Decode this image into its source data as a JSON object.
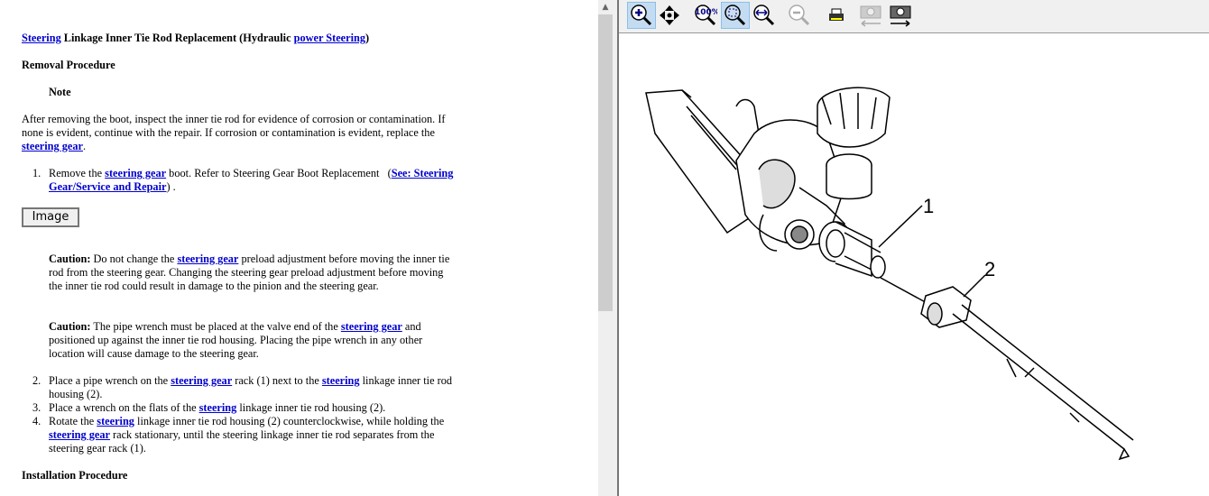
{
  "document": {
    "title": {
      "link1": "Steering",
      "text": " Linkage Inner Tie Rod Replacement (Hydraulic ",
      "link2": "power Steering",
      "end": ")"
    },
    "removal_heading": "Removal Procedure",
    "note_label": "Note",
    "note_text": {
      "a": "After removing the boot, inspect the inner tie rod for evidence of corrosion or contamination. If none is evident, continue with the repair. If corrosion or contamination is evident, replace the ",
      "link": "steering gear",
      "b": "."
    },
    "step1": {
      "num": "1.",
      "a": "Remove the ",
      "link": "steering gear",
      "b": " boot. Refer to Steering Gear Boot Replacement   (",
      "link2": "See: Steering Gear/Service and Repair",
      "c": ") ."
    },
    "image_button": "Image",
    "caution1": {
      "label": "Caution:",
      "a": " Do not change the ",
      "link": "steering gear",
      "b": " preload adjustment before moving the inner tie rod from the steering gear. Changing the steering gear preload adjustment before moving the inner tie rod could result in damage to the pinion and the steering gear."
    },
    "caution2": {
      "label": "Caution:",
      "a": " The pipe wrench must be placed at the valve end of the ",
      "link": "steering gear",
      "b": " and positioned up against the inner tie rod housing. Placing the pipe wrench in any other location will cause damage to the steering gear."
    },
    "step2": {
      "num": "2.",
      "a": "Place a pipe wrench on the ",
      "link": "steering gear",
      "b": " rack (1) next to the ",
      "link2": "steering",
      "c": " linkage inner tie rod housing (2)."
    },
    "step3": {
      "num": "3.",
      "a": "Place a wrench on the flats of the ",
      "link": "steering",
      "b": " linkage inner tie rod housing (2)."
    },
    "step4": {
      "num": "4.",
      "a": "Rotate the ",
      "link": "steering",
      "b": " linkage inner tie rod housing (2) counterclockwise, while holding the ",
      "link2": "steering gear",
      "c": " rack stationary, until the steering linkage inner tie rod separates from the steering gear rack (1)."
    },
    "install_heading": "Installation Procedure"
  },
  "toolbar": {
    "icons": [
      "zoom-in",
      "pan",
      "zoom-100",
      "zoom-fit",
      "zoom-width",
      "zoom-out",
      "print",
      "copy-image",
      "save-image"
    ],
    "active": [
      "zoom-in",
      "zoom-fit"
    ]
  },
  "diagram": {
    "callout1": "1",
    "callout2": "2"
  }
}
